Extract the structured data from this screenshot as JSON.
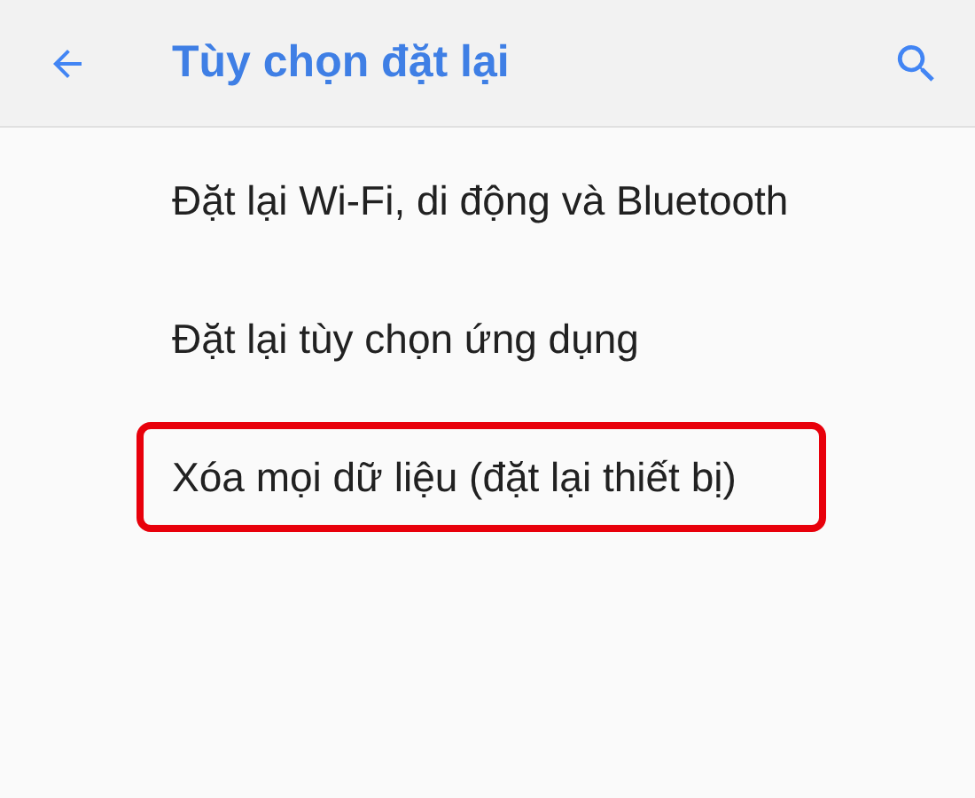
{
  "app_bar": {
    "title": "Tùy chọn đặt lại"
  },
  "items": [
    {
      "label": "Đặt lại Wi-Fi, di động và Bluetooth",
      "highlighted": false
    },
    {
      "label": "Đặt lại tùy chọn ứng dụng",
      "highlighted": false
    },
    {
      "label": "Xóa mọi dữ liệu (đặt lại thiết bị)",
      "highlighted": true
    }
  ]
}
